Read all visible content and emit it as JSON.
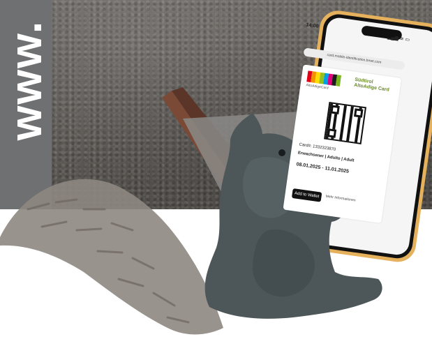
{
  "url_banner": {
    "text": "www."
  },
  "phone": {
    "status_time": "14:00",
    "status_icons": "▂▄▆ ≋ ▭",
    "address_text": "card.mobile-identification.bmet.com",
    "logo_caption": "AltoAdigeCard",
    "brand_text": "Südtirol AltoAdige Card",
    "card_id_line": "Card#: 1332323870",
    "card_type_line": "Erwachsener | Adulto | Adult",
    "validity_line": "08.01.2025 - 11.01.2025",
    "wallet_label": "Add to Wallet",
    "more_info_label": "Mehr Informationen"
  },
  "colors": {
    "strip_grey": "#6f7072",
    "squirrel_grey": "#4d5759",
    "tail_grey": "#8e8782",
    "phone_frame": "#e6b15c",
    "brand_green": "#6a8a2a"
  },
  "logo_stripe_colors": [
    "#e2001a",
    "#f39200",
    "#ffdd00",
    "#95c11f",
    "#009fe3",
    "#e5007d",
    "#1d1d1b",
    "#7ab51d"
  ]
}
